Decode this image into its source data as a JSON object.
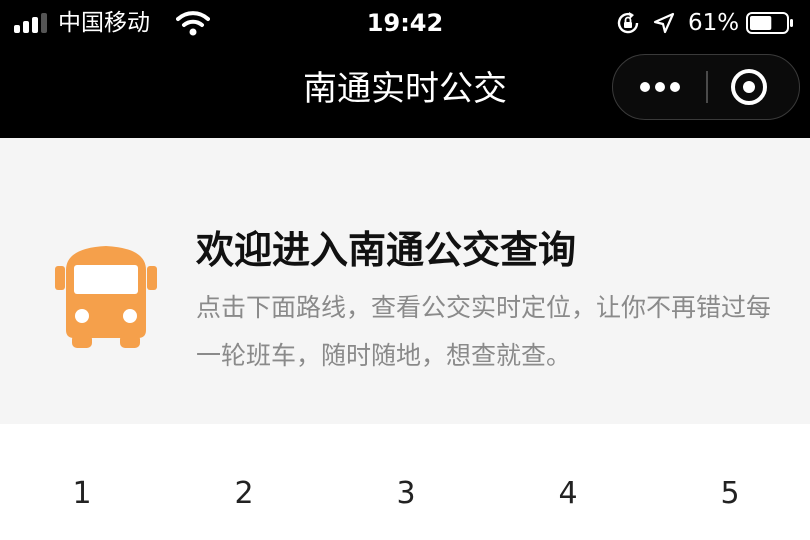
{
  "status_bar": {
    "carrier": "中国移动",
    "time": "19:42",
    "battery_percent": "61%",
    "battery_level": 0.61,
    "signal_bars_active": 3,
    "signal_bars_total": 4,
    "icons": [
      "signal-icon",
      "wifi-icon",
      "rotation-lock-icon",
      "location-arrow-icon",
      "battery-icon"
    ]
  },
  "nav": {
    "title": "南通实时公交",
    "capsule_icons": [
      "more-dots-icon",
      "close-target-icon"
    ]
  },
  "banner": {
    "icon": "bus-icon",
    "icon_color": "#F5A04B",
    "title": "欢迎进入南通公交查询",
    "description": "点击下面路线，查看公交实时定位，让你不再错过每一轮班车，随时随地，想查就查。"
  },
  "routes": [
    "1",
    "2",
    "3",
    "4",
    "5"
  ],
  "colors": {
    "bar_background": "#000000",
    "banner_background": "#F5F5F5",
    "accent": "#F5A04B"
  }
}
